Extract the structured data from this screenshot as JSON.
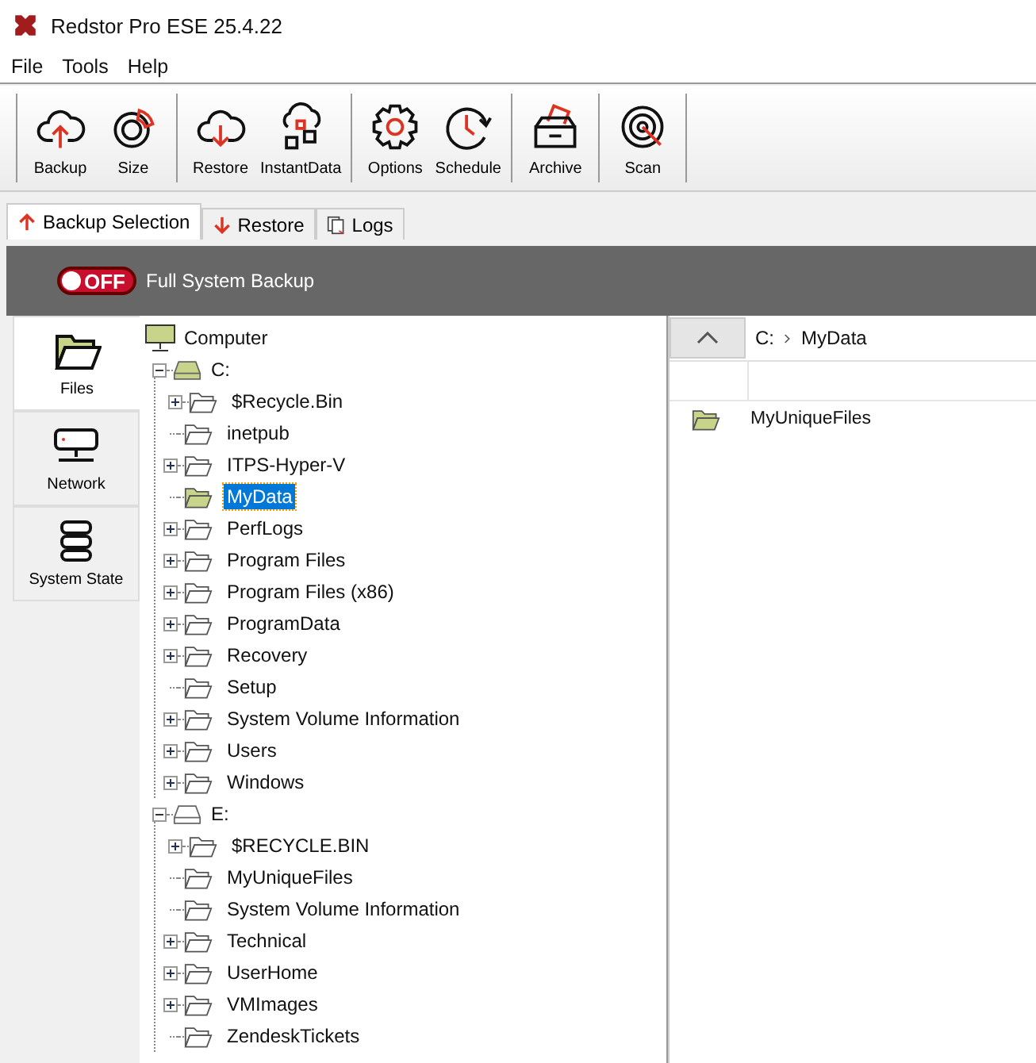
{
  "window": {
    "title": "Redstor Pro ESE 25.4.22"
  },
  "menu": [
    "File",
    "Tools",
    "Help"
  ],
  "toolbar": {
    "groups": [
      [
        {
          "label": "Backup"
        },
        {
          "label": "Size"
        }
      ],
      [
        {
          "label": "Restore"
        },
        {
          "label": "InstantData"
        }
      ],
      [
        {
          "label": "Options"
        },
        {
          "label": "Schedule"
        }
      ],
      [
        {
          "label": "Archive"
        }
      ],
      [
        {
          "label": "Scan"
        }
      ]
    ]
  },
  "tabs": [
    {
      "label": "Backup Selection",
      "selected": true
    },
    {
      "label": "Restore",
      "selected": false
    },
    {
      "label": "Logs",
      "selected": false
    }
  ],
  "full_system_backup": {
    "toggle_label": "OFF",
    "on": false,
    "label": "Full System Backup"
  },
  "sidebar": {
    "items": [
      {
        "label": "Files",
        "selected": true
      },
      {
        "label": "Network",
        "selected": false
      },
      {
        "label": "System State",
        "selected": false
      }
    ]
  },
  "tree": {
    "label": "Computer",
    "included": true,
    "children": [
      {
        "label": "C:",
        "included": true,
        "expanded": true,
        "children": [
          {
            "label": "$Recycle.Bin",
            "expandable": true,
            "selected": false
          },
          {
            "label": "inetpub",
            "expandable": false,
            "selected": false
          },
          {
            "label": "ITPS-Hyper-V",
            "expandable": true,
            "selected": false
          },
          {
            "label": "MyData",
            "expandable": false,
            "selected": true
          },
          {
            "label": "PerfLogs",
            "expandable": true,
            "selected": false
          },
          {
            "label": "Program Files",
            "expandable": true,
            "selected": false
          },
          {
            "label": "Program Files (x86)",
            "expandable": true,
            "selected": false
          },
          {
            "label": "ProgramData",
            "expandable": true,
            "selected": false
          },
          {
            "label": "Recovery",
            "expandable": true,
            "selected": false
          },
          {
            "label": "Setup",
            "expandable": false,
            "selected": false
          },
          {
            "label": "System Volume Information",
            "expandable": true,
            "selected": false
          },
          {
            "label": "Users",
            "expandable": true,
            "selected": false
          },
          {
            "label": "Windows",
            "expandable": true,
            "selected": false
          }
        ]
      },
      {
        "label": "E:",
        "included": false,
        "expanded": true,
        "children": [
          {
            "label": "$RECYCLE.BIN",
            "expandable": true,
            "selected": false
          },
          {
            "label": "MyUniqueFiles",
            "expandable": false,
            "selected": false
          },
          {
            "label": "System Volume Information",
            "expandable": false,
            "selected": false
          },
          {
            "label": "Technical",
            "expandable": true,
            "selected": false
          },
          {
            "label": "UserHome",
            "expandable": true,
            "selected": false
          },
          {
            "label": "VMImages",
            "expandable": true,
            "selected": false
          },
          {
            "label": "ZendeskTickets",
            "expandable": false,
            "selected": false
          }
        ]
      }
    ]
  },
  "browser": {
    "path": [
      "C:",
      "MyData"
    ],
    "items": [
      {
        "label": "MyUniqueFiles",
        "included": true
      }
    ]
  }
}
